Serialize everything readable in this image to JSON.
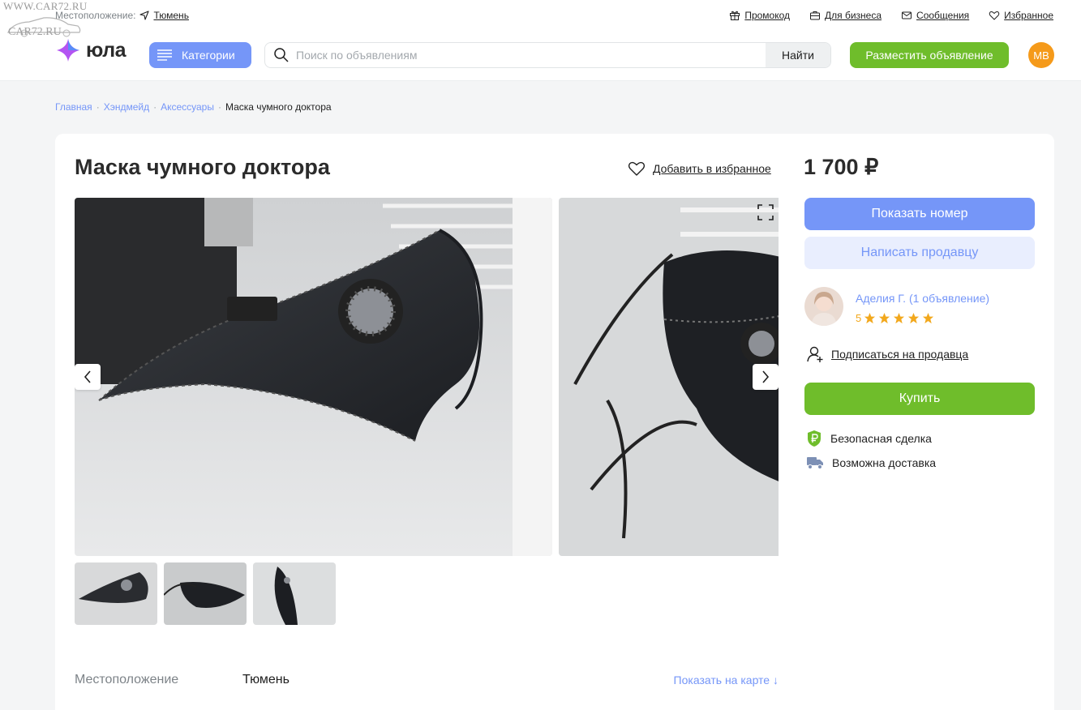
{
  "watermark": {
    "line1": "WWW.CAR72.RU",
    "line2": "CAR72.RU"
  },
  "header": {
    "location_label": "Местоположение:",
    "location_city": "Тюмень",
    "links": [
      {
        "label": "Промокод",
        "icon": "gift-icon"
      },
      {
        "label": "Для бизнеса",
        "icon": "briefcase-icon"
      },
      {
        "label": "Сообщения",
        "icon": "mail-icon"
      },
      {
        "label": "Избранное",
        "icon": "heart-icon"
      }
    ],
    "logo_text": "юла",
    "categories_label": "Категории",
    "search_placeholder": "Поиск по объявлениям",
    "search_button": "Найти",
    "post_button": "Разместить объявление",
    "user_initials": "МВ"
  },
  "breadcrumbs": [
    {
      "label": "Главная"
    },
    {
      "label": "Хэндмейд"
    },
    {
      "label": "Аксессуары"
    },
    {
      "label": "Маска чумного доктора"
    }
  ],
  "listing": {
    "title": "Маска чумного доктора",
    "favorite_label": "Добавить в избранное",
    "price": "1 700 ₽",
    "show_phone_button": "Показать номер",
    "write_seller_button": "Написать продавцу",
    "seller": {
      "name": "Аделия Г. (1 объявление)",
      "rating": "5",
      "stars": 5
    },
    "subscribe_label": "Подписаться на продавца",
    "buy_button": "Купить",
    "features": [
      "Безопасная сделка",
      "Возможна доставка"
    ],
    "location": {
      "label": "Местоположение",
      "value": "Тюмень",
      "map_link": "Показать на карте ↓"
    },
    "photo_count": 3
  },
  "colors": {
    "accent": "#7596f8",
    "green": "#6fbd2b",
    "avatar": "#f59a1a",
    "star": "#f2a81d"
  }
}
